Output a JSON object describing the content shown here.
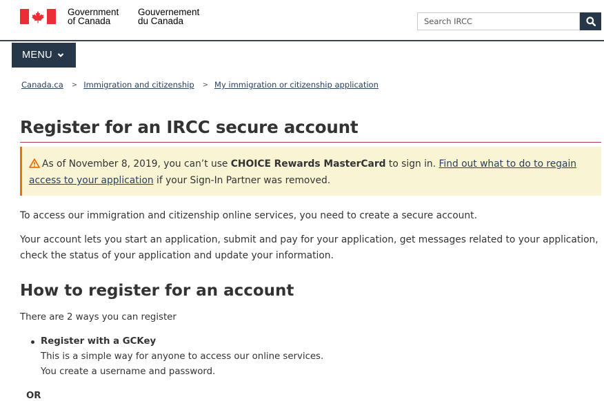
{
  "header": {
    "wordmark_en_line1": "Government",
    "wordmark_en_line2": "of Canada",
    "wordmark_fr_line1": "Gouvernement",
    "wordmark_fr_line2": "du Canada",
    "search_placeholder": "Search IRCC",
    "search_icon": "magnifier-icon"
  },
  "menu": {
    "label": "MENU"
  },
  "breadcrumb": [
    "Canada.ca",
    "Immigration and citizenship",
    "My immigration or citizenship application"
  ],
  "page": {
    "title": "Register for an IRCC secure account",
    "alert": {
      "prefix": "As of November 8, 2019, you can’t use ",
      "bold": "CHOICE Rewards MasterCard",
      "mid": " to sign in. ",
      "link": "Find out what to do to regain access to your application",
      "suffix": " if your Sign-In Partner was removed."
    },
    "intro": "To access our immigration and citizenship online services, you need to create a secure account.",
    "details": "Your account lets you start an application, submit and pay for your application, get messages related to your application, check the status of your application and update your information.",
    "section_heading": "How to register for an account",
    "section_intro": "There are 2 ways you can register",
    "options": [
      {
        "title": "Register with a GCKey",
        "line1": "This is a simple way for anyone to access our online services.",
        "line2": "You create a username and password."
      }
    ],
    "or_label": "OR"
  },
  "colors": {
    "navy": "#26374a",
    "link": "#284162",
    "title_rule": "#af3c43",
    "alert_bg": "#f9f4d4",
    "alert_border": "#ee7100",
    "flag_red": "#eb2d37"
  }
}
